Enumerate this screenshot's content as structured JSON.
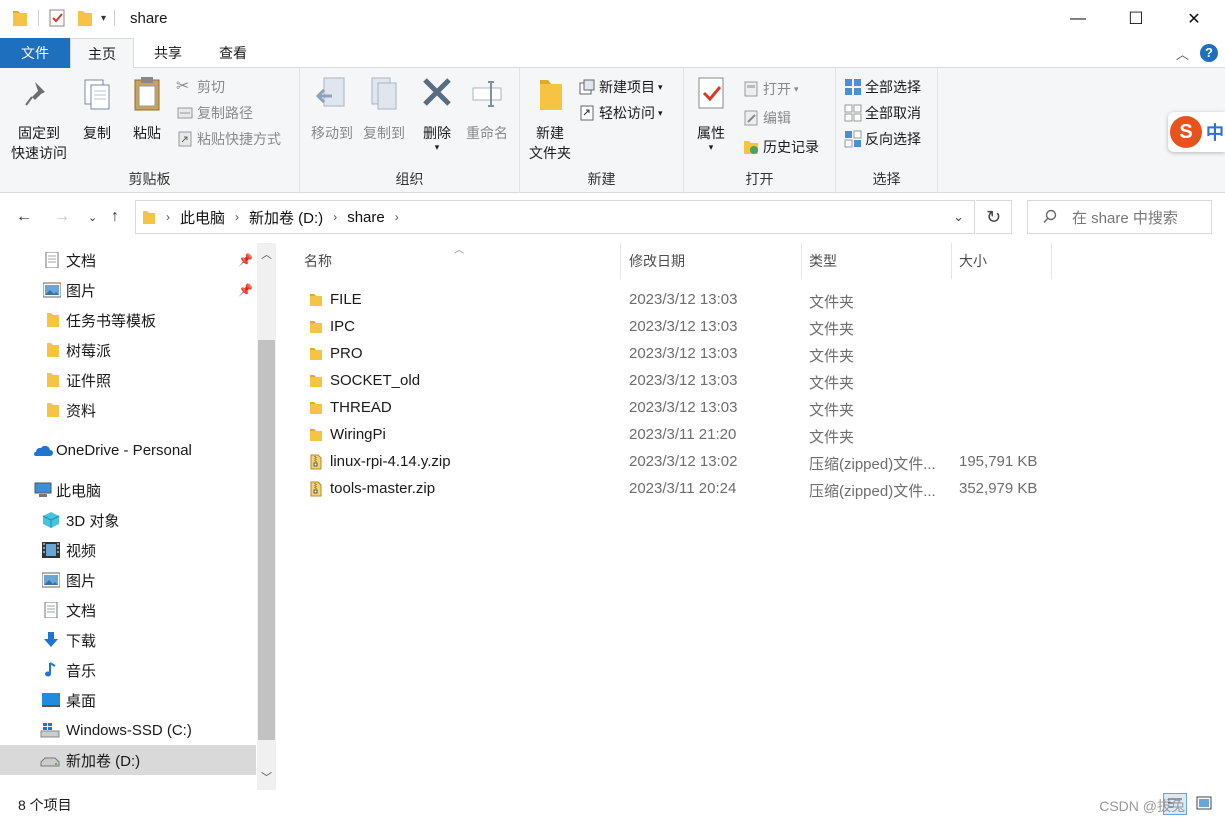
{
  "window": {
    "title": "share",
    "controls": {
      "minimize": "—",
      "maximize": "☐",
      "close": "✕"
    }
  },
  "ribbon_tabs": [
    "文件",
    "主页",
    "共享",
    "查看"
  ],
  "ribbon": {
    "clipboard": {
      "label": "剪贴板",
      "pin_line1": "固定到",
      "pin_line2": "快速访问",
      "copy": "复制",
      "paste": "粘贴",
      "cut": "剪切",
      "copy_path": "复制路径",
      "paste_shortcut": "粘贴快捷方式"
    },
    "organize": {
      "label": "组织",
      "move_to": "移动到",
      "copy_to": "复制到",
      "delete": "删除",
      "rename": "重命名"
    },
    "new": {
      "label": "新建",
      "new_folder_line1": "新建",
      "new_folder_line2": "文件夹",
      "new_item": "新建项目",
      "easy_access": "轻松访问"
    },
    "open": {
      "label": "打开",
      "properties": "属性",
      "open": "打开",
      "edit": "编辑",
      "history": "历史记录"
    },
    "select": {
      "label": "选择",
      "select_all": "全部选择",
      "select_none": "全部取消",
      "invert": "反向选择"
    },
    "ime_badge": "中"
  },
  "address": {
    "crumbs": [
      "此电脑",
      "新加卷 (D:)",
      "share"
    ],
    "search_placeholder": "在 share 中搜索"
  },
  "nav": {
    "quick_access": [
      {
        "label": "文档",
        "icon": "document-icon",
        "pinned": true
      },
      {
        "label": "图片",
        "icon": "picture-icon",
        "pinned": true
      },
      {
        "label": "任务书等模板",
        "icon": "folder-icon",
        "pinned": false
      },
      {
        "label": "树莓派",
        "icon": "folder-icon",
        "pinned": false
      },
      {
        "label": "证件照",
        "icon": "folder-icon",
        "pinned": false
      },
      {
        "label": "资料",
        "icon": "folder-icon",
        "pinned": false
      }
    ],
    "onedrive": "OneDrive - Personal",
    "this_pc": "此电脑",
    "pc_items": [
      {
        "label": "3D 对象",
        "icon": "3d-objects-icon"
      },
      {
        "label": "视频",
        "icon": "video-icon"
      },
      {
        "label": "图片",
        "icon": "picture-icon"
      },
      {
        "label": "文档",
        "icon": "document-icon"
      },
      {
        "label": "下载",
        "icon": "download-icon"
      },
      {
        "label": "音乐",
        "icon": "music-icon"
      },
      {
        "label": "桌面",
        "icon": "desktop-icon"
      },
      {
        "label": "Windows-SSD (C:)",
        "icon": "windows-drive-icon"
      },
      {
        "label": "新加卷 (D:)",
        "icon": "drive-icon"
      }
    ]
  },
  "columns": {
    "name": "名称",
    "date": "修改日期",
    "type": "类型",
    "size": "大小"
  },
  "files": [
    {
      "name": "FILE",
      "date": "2023/3/12 13:03",
      "type": "文件夹",
      "size": "",
      "icon": "folder-icon"
    },
    {
      "name": "IPC",
      "date": "2023/3/12 13:03",
      "type": "文件夹",
      "size": "",
      "icon": "folder-icon"
    },
    {
      "name": "PRO",
      "date": "2023/3/12 13:03",
      "type": "文件夹",
      "size": "",
      "icon": "folder-icon"
    },
    {
      "name": "SOCKET_old",
      "date": "2023/3/12 13:03",
      "type": "文件夹",
      "size": "",
      "icon": "folder-icon"
    },
    {
      "name": "THREAD",
      "date": "2023/3/12 13:03",
      "type": "文件夹",
      "size": "",
      "icon": "folder-icon"
    },
    {
      "name": "WiringPi",
      "date": "2023/3/11 21:20",
      "type": "文件夹",
      "size": "",
      "icon": "folder-icon"
    },
    {
      "name": "linux-rpi-4.14.y.zip",
      "date": "2023/3/12 13:02",
      "type": "压缩(zipped)文件...",
      "size": "195,791 KB",
      "icon": "zip-icon"
    },
    {
      "name": "tools-master.zip",
      "date": "2023/3/11 20:24",
      "type": "压缩(zipped)文件...",
      "size": "352,979 KB",
      "icon": "zip-icon"
    }
  ],
  "status": {
    "count": "8 个项目"
  },
  "watermark": "CSDN @拔兔"
}
